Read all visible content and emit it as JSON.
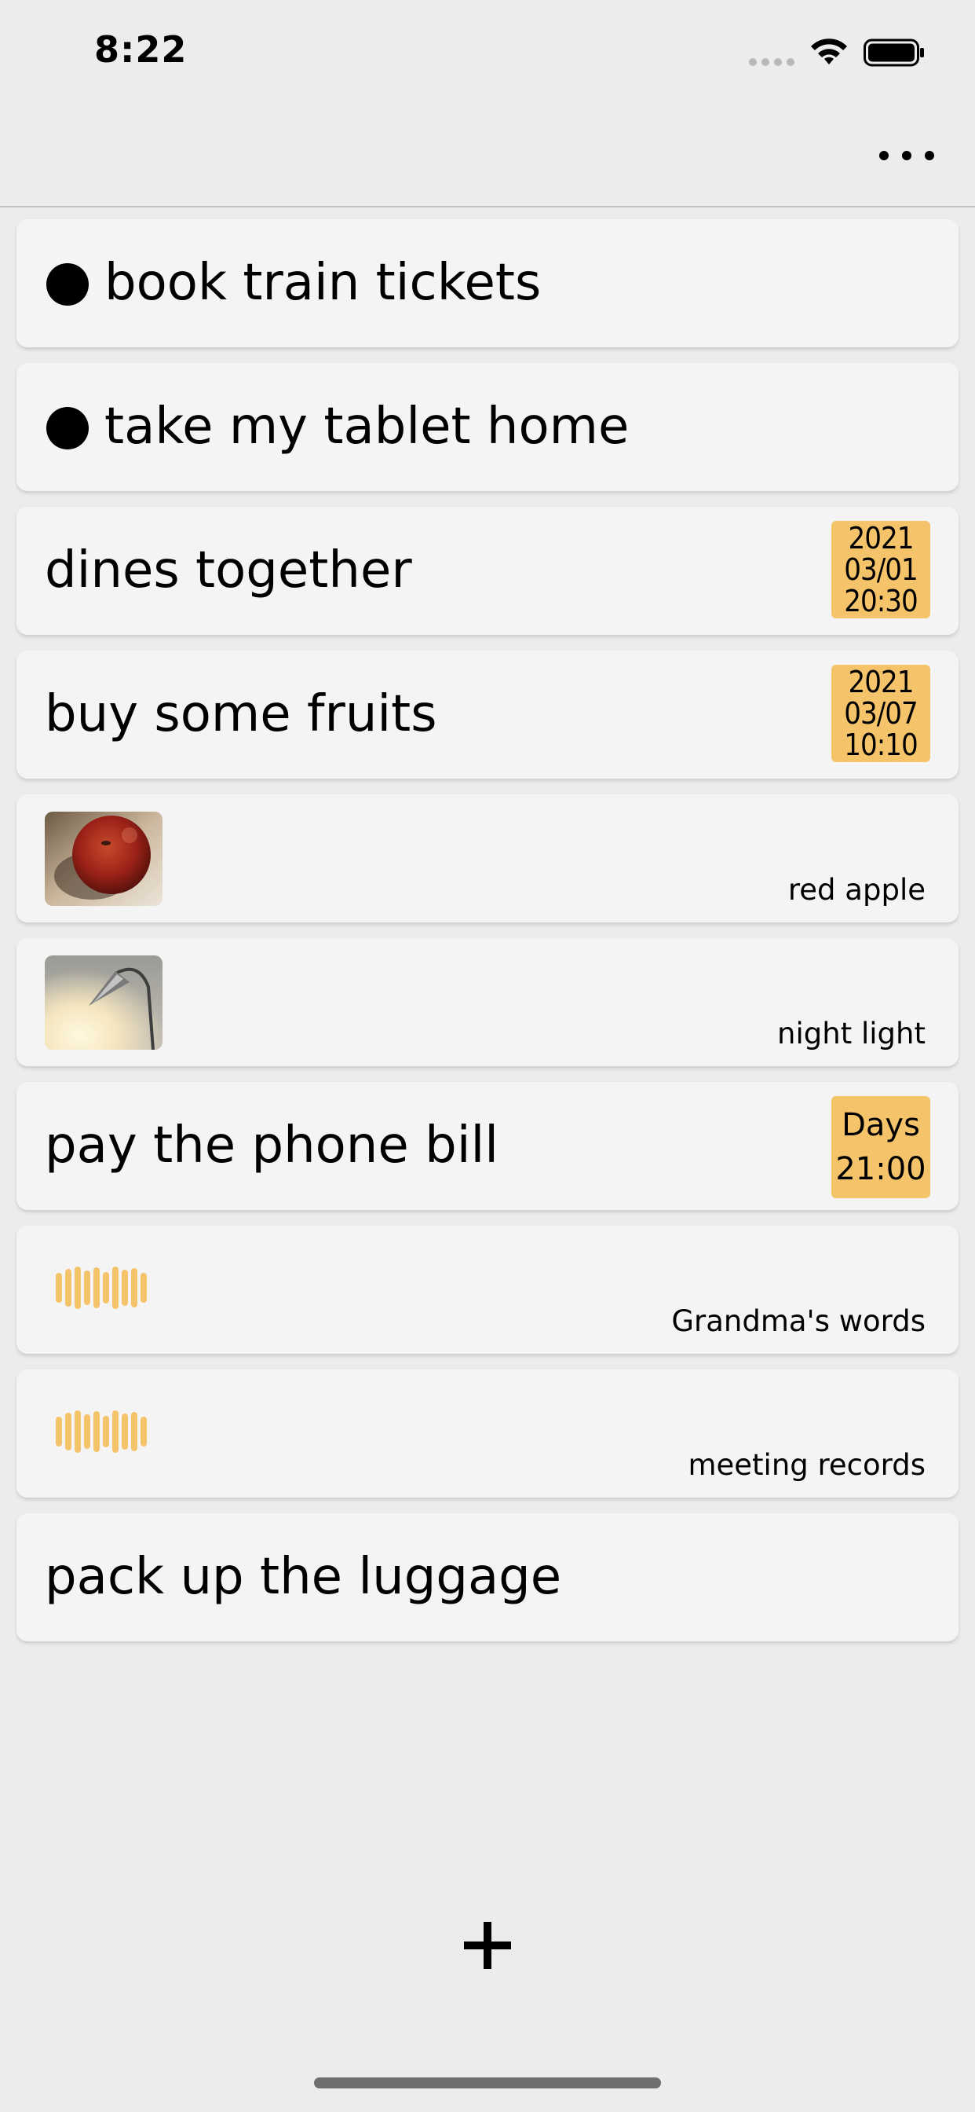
{
  "status_bar": {
    "time": "8:22",
    "icons": [
      "signal-icon",
      "wifi-icon",
      "battery-icon"
    ]
  },
  "nav": {
    "more_icon": "more-icon"
  },
  "items": [
    {
      "type": "dot",
      "text": "book train tickets"
    },
    {
      "type": "dot",
      "text": "take my tablet home"
    },
    {
      "type": "dated",
      "text": "dines together",
      "date_year": "2021",
      "date_md": "03/01",
      "date_time": "20:30"
    },
    {
      "type": "dated",
      "text": "buy some fruits",
      "date_year": "2021",
      "date_md": "03/07",
      "date_time": "10:10"
    },
    {
      "type": "image",
      "image": "apple-photo",
      "caption": "red apple"
    },
    {
      "type": "image",
      "image": "lamp-photo",
      "caption": "night light"
    },
    {
      "type": "repeat",
      "text": "pay the phone bill",
      "repeat": "Days",
      "time": "21:00"
    },
    {
      "type": "audio",
      "icon": "waveform-icon",
      "caption": "Grandma's words"
    },
    {
      "type": "audio",
      "icon": "waveform-icon",
      "caption": "meeting records"
    },
    {
      "type": "plain",
      "text": "pack up the luggage"
    }
  ],
  "add_icon": "plus-icon",
  "colors": {
    "background": "#ececec",
    "card": "#f4f4f4",
    "accent": "#f5c46a"
  }
}
